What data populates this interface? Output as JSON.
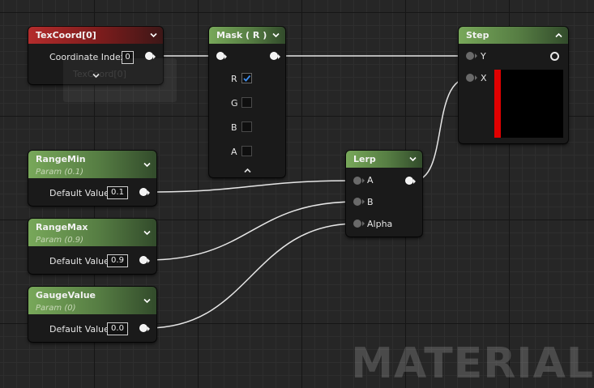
{
  "watermark": "MATERIAL",
  "nodes": {
    "texcoord": {
      "title": "TexCoord[0]",
      "pin_label": "Coordinate Index",
      "value": "0",
      "ghost_label": "TexCoord[0]"
    },
    "mask": {
      "title": "Mask ( R )",
      "channels": [
        {
          "label": "R",
          "checked": true
        },
        {
          "label": "G",
          "checked": false
        },
        {
          "label": "B",
          "checked": false
        },
        {
          "label": "A",
          "checked": false
        }
      ]
    },
    "step": {
      "title": "Step",
      "inputs": [
        "Y",
        "X"
      ]
    },
    "lerp": {
      "title": "Lerp",
      "inputs": [
        "A",
        "B",
        "Alpha"
      ]
    },
    "rangemin": {
      "title": "RangeMin",
      "subtitle": "Param (0.1)",
      "pin_label": "Default Value",
      "value": "0.1"
    },
    "rangemax": {
      "title": "RangeMax",
      "subtitle": "Param (0.9)",
      "pin_label": "Default Value",
      "value": "0.9"
    },
    "gaugevalue": {
      "title": "GaugeValue",
      "subtitle": "Param (0)",
      "pin_label": "Default Value",
      "value": "0.0"
    }
  },
  "colors": {
    "wire": "#e6e6e6",
    "preview_bar": "#e00000",
    "header_red": "#b42c2c",
    "header_green": "#78a85a"
  }
}
